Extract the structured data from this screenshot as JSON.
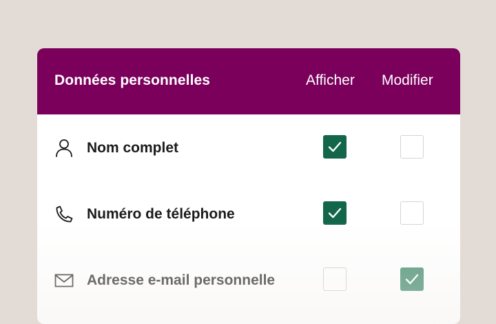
{
  "header": {
    "title": "Données personnelles",
    "columns": [
      "Afficher",
      "Modifier"
    ]
  },
  "rows": [
    {
      "label": "Nom complet",
      "icon": "person-icon",
      "afficher": true,
      "modifier": false
    },
    {
      "label": "Numéro de téléphone",
      "icon": "phone-icon",
      "afficher": true,
      "modifier": false
    },
    {
      "label": "Adresse e-mail personnelle",
      "icon": "mail-icon",
      "afficher": false,
      "modifier": true
    }
  ],
  "colors": {
    "background": "#e3dbd5",
    "header": "#7a005b",
    "checked": "#136649",
    "checked_soft": "#5c9b82"
  }
}
